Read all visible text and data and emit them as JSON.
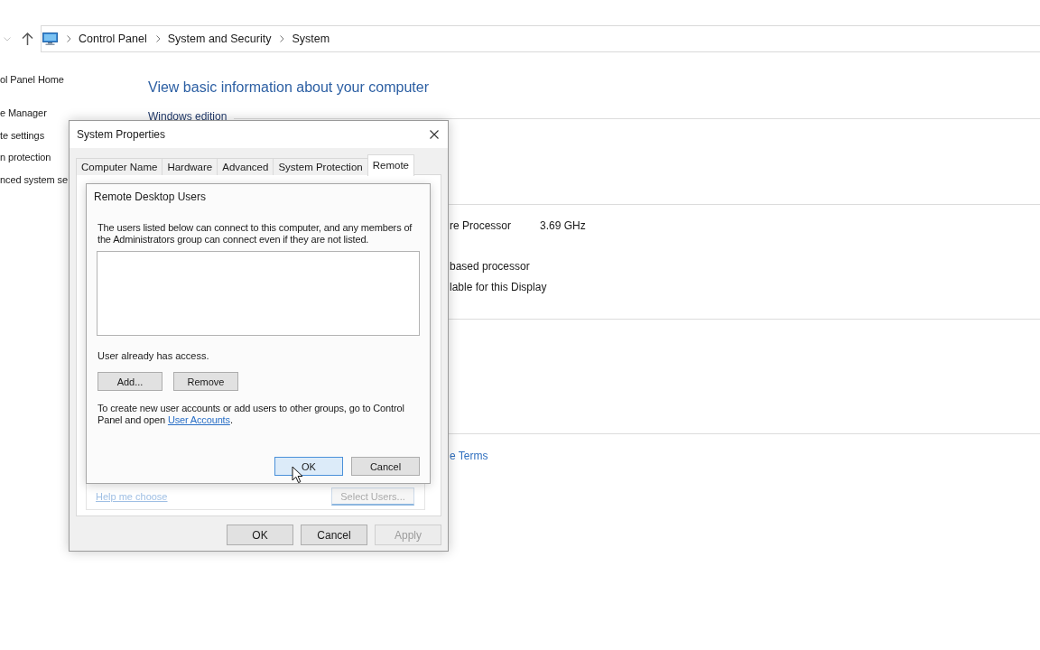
{
  "control_panel": {
    "address_bar": {
      "path": [
        "Control Panel",
        "System and Security",
        "System"
      ]
    },
    "sidebar": {
      "items": [
        "ol Panel Home",
        "e Manager",
        "te settings",
        "n protection",
        "nced system se"
      ]
    },
    "heading": "View basic information about your computer",
    "section_title": "Windows edition",
    "details": [
      {
        "text": "re Processor",
        "value": "3.69 GHz"
      },
      {
        "text": "based processor"
      },
      {
        "text": "lable for this Display"
      }
    ],
    "link": "e Terms"
  },
  "system_properties": {
    "title": "System Properties",
    "tabs": [
      {
        "label": "Computer Name",
        "selected": false
      },
      {
        "label": "Hardware",
        "selected": false
      },
      {
        "label": "Advanced",
        "selected": false
      },
      {
        "label": "System Protection",
        "selected": false
      },
      {
        "label": "Remote",
        "selected": true
      }
    ],
    "remote_tab": {
      "help_link": "Help me choose",
      "select_users_button": "Select Users..."
    },
    "buttons": [
      {
        "label": "OK",
        "disabled": false
      },
      {
        "label": "Cancel",
        "disabled": false
      },
      {
        "label": "Apply",
        "disabled": true
      }
    ]
  },
  "remote_desktop_users": {
    "title": "Remote Desktop Users",
    "description": "The users listed below can connect to this computer, and any members of the Administrators group can connect even if they are not listed.",
    "status": "User already has access.",
    "list_buttons": [
      {
        "label": "Add..."
      },
      {
        "label": "Remove"
      }
    ],
    "note": {
      "text": "To create new user accounts or add users to other groups, go to Control Panel and open ",
      "link": "User Accounts",
      "after": "."
    },
    "buttons": [
      {
        "label": "OK",
        "focused": true
      },
      {
        "label": "Cancel",
        "focused": false
      }
    ]
  }
}
